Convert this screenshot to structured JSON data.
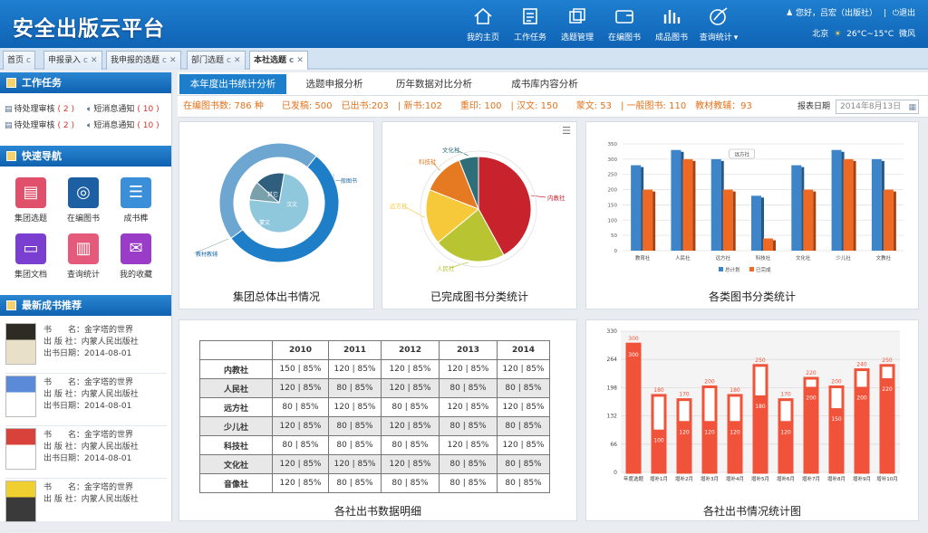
{
  "app": {
    "title": "安全出版云平台"
  },
  "nav": [
    {
      "label": "我的主页",
      "icon": "home-icon"
    },
    {
      "label": "工作任务",
      "icon": "task-icon"
    },
    {
      "label": "选题管理",
      "icon": "topic-icon"
    },
    {
      "label": "在编图书",
      "icon": "book-edit-icon"
    },
    {
      "label": "成品图书",
      "icon": "bars-icon"
    },
    {
      "label": "查询统计",
      "icon": "stats-icon"
    }
  ],
  "user": {
    "greeting": "您好，吕宏（出版社）",
    "logout": "退出"
  },
  "weather": {
    "city": "北京",
    "temp": "26°C~15°C",
    "wind": "微风"
  },
  "tabs": [
    {
      "label": "首页"
    },
    {
      "label": "申报录入"
    },
    {
      "label": "我申报的选题"
    },
    {
      "label": "部门选题"
    },
    {
      "label": "本社选题"
    }
  ],
  "sidebar": {
    "work_title": "工作任务",
    "tasks": [
      {
        "label": "待处理审核",
        "count": "( 2 )"
      },
      {
        "label": "短消息通知",
        "count": "( 10 )"
      },
      {
        "label": "待处理审核",
        "count": "( 2 )"
      },
      {
        "label": "短消息通知",
        "count": "( 10 )"
      }
    ],
    "quick_title": "快速导航",
    "quick": [
      {
        "label": "集团选题",
        "color": "#e0506a"
      },
      {
        "label": "在编图书",
        "color": "#1c5fa3"
      },
      {
        "label": "成书榫",
        "color": "#3b8fd8"
      },
      {
        "label": "集团文档",
        "color": "#7a3fd0"
      },
      {
        "label": "查询统计",
        "color": "#e55a7a"
      },
      {
        "label": "我的收藏",
        "color": "#9a3cc8"
      }
    ],
    "books_title": "最新成书推荐",
    "books": [
      {
        "name": "书　　名：金字塔的世界",
        "press": "出 版 社：内蒙人民出版社",
        "date": "出书日期：2014-08-01"
      },
      {
        "name": "书　　名：金字塔的世界",
        "press": "出 版 社：内蒙人民出版社",
        "date": "出书日期：2014-08-01"
      },
      {
        "name": "书　　名：金字塔的世界",
        "press": "出 版 社：内蒙人民出版社",
        "date": "出书日期：2014-08-01"
      },
      {
        "name": "书　　名：金字塔的世界",
        "press": "出 版 社：内蒙人民出版社",
        "date": ""
      }
    ]
  },
  "main": {
    "tabs": [
      "本年度出书统计分析",
      "选题申报分析",
      "历年数据对比分析",
      "成书库内容分析"
    ],
    "stats": "在编图书数: 786 种　　已发稿: 500　已出书:203　| 新书:102　　重印:  100　| 汉文: 150　　蒙文: 53　| 一般图书: 110　教材教辅：93",
    "date_label": "报表日期",
    "date_value": "2014年8月13日"
  },
  "chart_data": [
    {
      "type": "pie",
      "title": "集团总体出书情况",
      "rings": [
        {
          "name": "outer",
          "slices": [
            {
              "label": "一般图书",
              "value": 110
            },
            {
              "label": "教材教辅",
              "value": 93
            }
          ],
          "colors": [
            "#1e7fc8",
            "#6ea6d2"
          ]
        },
        {
          "name": "inner",
          "slices": [
            {
              "label": "汉文",
              "value": 150
            },
            {
              "label": "蒙文",
              "value": 53
            }
          ],
          "colors": [
            "#8fc7dc",
            "#7aa0ac"
          ]
        },
        {
          "name": "small",
          "slices": [
            {
              "label": "其它",
              "value": 12
            }
          ],
          "colors": [
            "#2f5f7c"
          ]
        }
      ]
    },
    {
      "type": "pie",
      "title": "已完成图书分类统计",
      "slices": [
        {
          "label": "内教社",
          "value": 42,
          "color": "#c8232c"
        },
        {
          "label": "人民社",
          "value": 22,
          "color": "#b8c432"
        },
        {
          "label": "远方社",
          "value": 17,
          "color": "#f6c93a"
        },
        {
          "label": "科技社",
          "value": 13,
          "color": "#e67a22"
        },
        {
          "label": "文化社",
          "value": 6,
          "color": "#2e6e78"
        }
      ]
    },
    {
      "type": "bar",
      "title": "各类图书分类统计",
      "categories": [
        "教育社",
        "人民社",
        "远方社",
        "科技社",
        "文化社",
        "少儿社",
        "文教社"
      ],
      "series": [
        {
          "name": "总计划",
          "values": [
            280,
            330,
            300,
            180,
            280,
            330,
            300
          ],
          "color": "#3d85c8"
        },
        {
          "name": "已完成",
          "values": [
            200,
            300,
            200,
            40,
            200,
            300,
            200
          ],
          "color": "#ee6a24"
        }
      ],
      "ylim": [
        0,
        350
      ],
      "yticks": [
        0,
        50,
        100,
        150,
        200,
        250,
        300,
        350
      ],
      "callout": "远方社"
    },
    {
      "type": "table",
      "title": "各社出书数据明细",
      "columns": [
        "",
        "2010",
        "2011",
        "2012",
        "2013",
        "2014"
      ],
      "rows": [
        [
          "内教社",
          "150 | 85%",
          "120 | 85%",
          "120 | 85%",
          "120 | 85%",
          "120 | 85%"
        ],
        [
          "人民社",
          "120 | 85%",
          "80 | 85%",
          "120 | 85%",
          "80 | 85%",
          "80 | 85%"
        ],
        [
          "远方社",
          "80 | 85%",
          "120 | 85%",
          "80 | 85%",
          "120 | 85%",
          "120 | 85%"
        ],
        [
          "少儿社",
          "120 | 85%",
          "80 | 85%",
          "120 | 85%",
          "80 | 85%",
          "80 | 85%"
        ],
        [
          "科技社",
          "80 | 85%",
          "80 | 85%",
          "80 | 85%",
          "120 | 85%",
          "120 | 85%"
        ],
        [
          "文化社",
          "120 | 85%",
          "120 | 85%",
          "120 | 85%",
          "80 | 85%",
          "80 | 85%"
        ],
        [
          "音像社",
          "120 | 85%",
          "80 | 85%",
          "80 | 85%",
          "80 | 85%",
          "80 | 85%"
        ]
      ]
    },
    {
      "type": "bar",
      "title": "各社出书情况统计图",
      "categories": [
        "年度选题",
        "增补1月",
        "增补2月",
        "增补3月",
        "增补4月",
        "增补5月",
        "增补6月",
        "增补7月",
        "增补8月",
        "增补9月",
        "增补10月"
      ],
      "series": [
        {
          "name": "计划",
          "values": [
            300,
            180,
            170,
            200,
            180,
            250,
            170,
            220,
            200,
            240,
            250
          ]
        },
        {
          "name": "完成",
          "values": [
            300,
            100,
            120,
            120,
            120,
            180,
            120,
            200,
            150,
            200,
            220
          ]
        }
      ],
      "ylim": [
        0,
        330
      ],
      "yticks": [
        0,
        66,
        132,
        198,
        264,
        330
      ],
      "color": "#f0533a"
    }
  ]
}
